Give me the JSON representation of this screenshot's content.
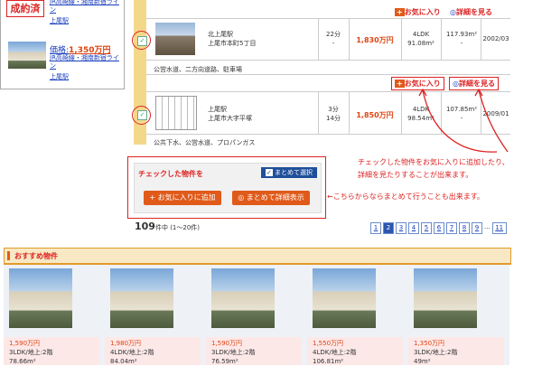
{
  "left_panel": {
    "sold_label": "成約済",
    "top_link_partial": "JR高崎線・湘南新宿ライン",
    "top_station": "上尾駅",
    "item": {
      "price_prefix": "価格:",
      "price": "1,350万円",
      "line": "JR高崎線・湘南新宿ライン",
      "station": "上尾駅"
    }
  },
  "top_buttons": {
    "fav": "お気に入り",
    "detail": "詳細を見る"
  },
  "listings": [
    {
      "station": "北上尾駅",
      "address": "上尾市本町5丁目",
      "walk": "22分",
      "walk2": "-",
      "price": "1,830万円",
      "layout": "4LDK",
      "area1": "91.08m²",
      "area2": "117.93m²",
      "area2b": "-",
      "built": "2002/03",
      "extra": "公営水道、二方向道路、駐車場",
      "fav": "お気に入り",
      "detail": "詳細を見る"
    },
    {
      "station": "上尾駅",
      "address": "上尾市大字平塚",
      "walk": "3分",
      "walk2": "14分",
      "price": "1,850万円",
      "layout": "4LDK",
      "area1": "98.54m²",
      "area2": "107.85m²",
      "area2b": "-",
      "built": "2009/01",
      "extra": "公共下水、公営水道、プロパンガス"
    }
  ],
  "bulk": {
    "title": "チェックした物件を",
    "select_all": "まとめて選択",
    "add_fav": "お気に入りに追加",
    "show_detail": "まとめて詳細表示"
  },
  "annotations": {
    "note1_line1": "チェックした物件をお気に入りに追加したり、",
    "note1_line2": "詳細を見たりすることが出来ます。",
    "note2": "←こちらからならまとめて行うことも出来ます。"
  },
  "pagination": {
    "count": "109",
    "count_suffix": "件中 (1〜20件)",
    "pages": [
      "1",
      "2",
      "3",
      "4",
      "5",
      "6",
      "7",
      "8",
      "9",
      "...",
      "11"
    ],
    "active": "2"
  },
  "recommended": {
    "title": "おすすめ物件",
    "items": [
      {
        "price": "1,590万円",
        "spec": "3LDK/地上:2階",
        "area": "78.66m²"
      },
      {
        "price": "1,980万円",
        "spec": "4LDK/地上:2階",
        "area": "84.04m²"
      },
      {
        "price": "1,590万円",
        "spec": "3LDK/地上:2階",
        "area": "76.59m²"
      },
      {
        "price": "1,550万円",
        "spec": "4LDK/地上:2階",
        "area": "106.81m²"
      },
      {
        "price": "1,350万円",
        "spec": "3LDK/地上:2階",
        "area": "49m²"
      }
    ]
  },
  "colors": {
    "accent_red": "#d22222",
    "price_red": "#dd4411",
    "orange": "#e05a1a",
    "yellow": "#f3d88a",
    "link_blue": "#1a3fbd"
  }
}
